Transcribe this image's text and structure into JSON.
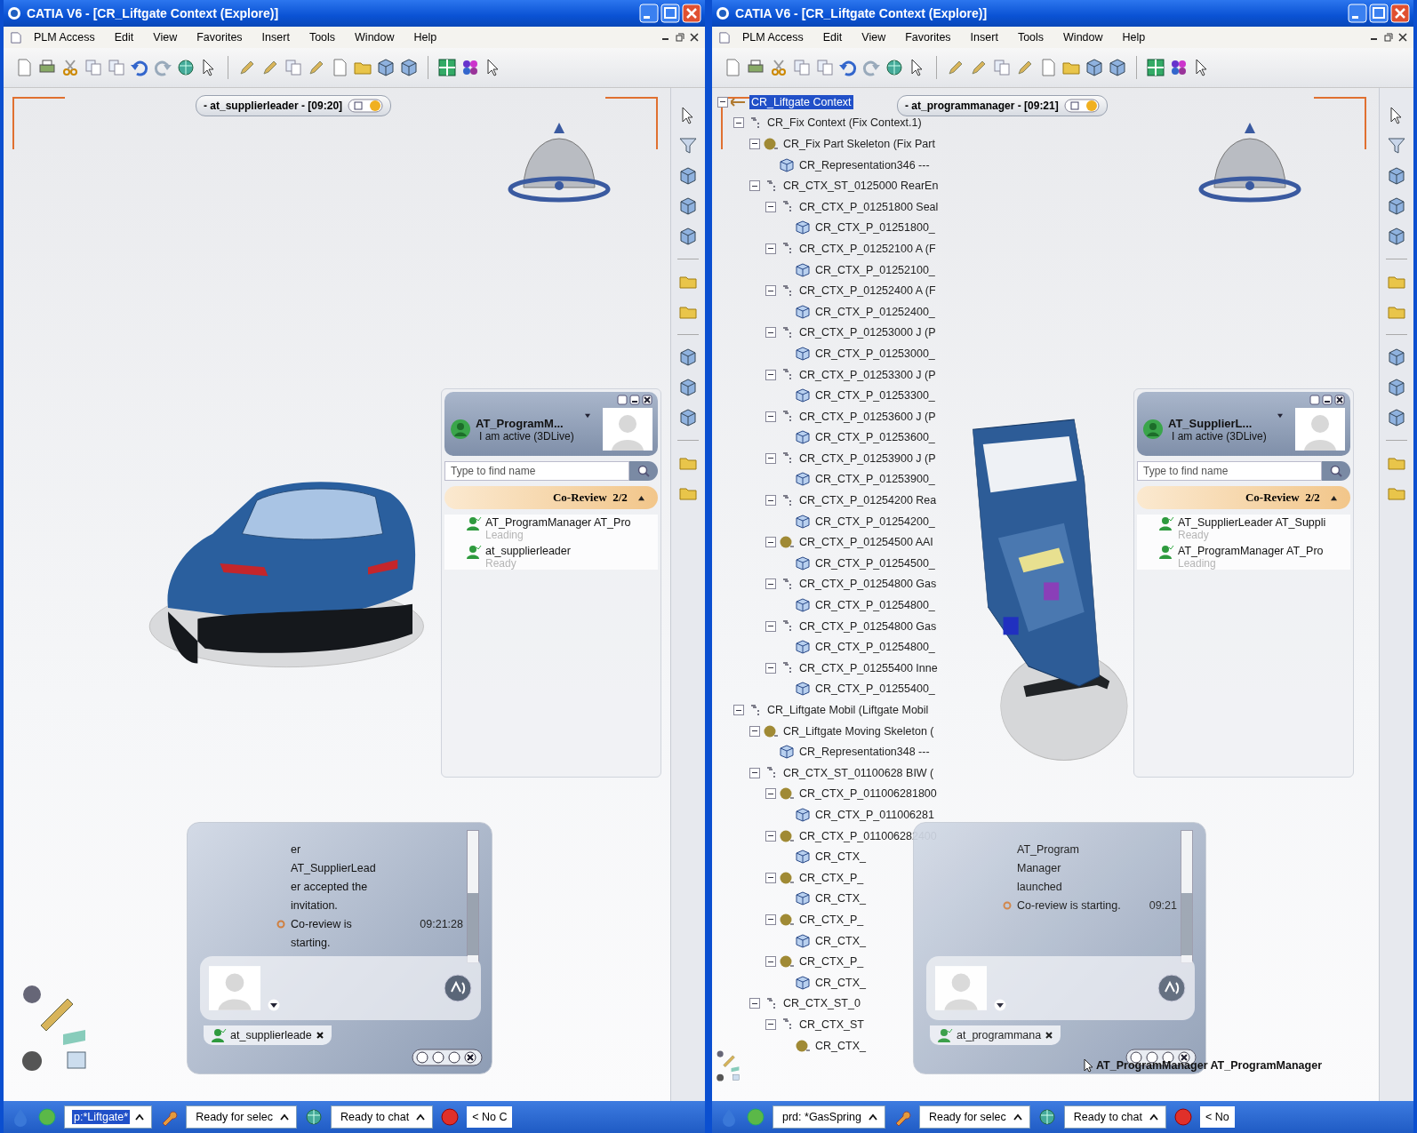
{
  "windows": [
    {
      "title": "CATIA V6 - [CR_Liftgate Context (Explore)]",
      "menu": [
        "PLM Access",
        "Edit",
        "View",
        "Favorites",
        "Insert",
        "Tools",
        "Window",
        "Help"
      ],
      "session": "- at_supplierleader - [09:20]",
      "model": {
        "kind": "car"
      },
      "contacts": {
        "name": "AT_ProgramM...",
        "status": "I am active (3DLive)",
        "search": {
          "placeholder": "Type to find name"
        },
        "group": {
          "label": "Co-Review  2/2",
          "expanded": true
        },
        "members": [
          {
            "name": "AT_ProgramManager AT_Pro",
            "state": "Leading"
          },
          {
            "name": "at_supplierleader",
            "state": "Ready"
          }
        ]
      },
      "chat": {
        "messages": [
          {
            "kind": "continuation",
            "lines": [
              "er",
              "AT_SupplierLead",
              "er accepted the",
              "invitation."
            ]
          },
          {
            "kind": "event",
            "lines": [
              "Co-review is",
              "starting."
            ],
            "time": "09:21:28"
          }
        ],
        "participant": "at_supplierleade"
      },
      "status_bar": [
        {
          "kind": "dropdown",
          "text": "p:*Liftgate*",
          "highlighted": true
        },
        {
          "kind": "dropdown",
          "text": "Ready for selec",
          "highlighted": false
        },
        {
          "kind": "dropdown",
          "text": "Ready to chat",
          "highlighted": false
        },
        {
          "kind": "label",
          "text": "< No C"
        }
      ]
    },
    {
      "title": "CATIA V6 - [CR_Liftgate Context (Explore)]",
      "menu": [
        "PLM Access",
        "Edit",
        "View",
        "Favorites",
        "Insert",
        "Tools",
        "Window",
        "Help"
      ],
      "session": "- at_programmanager - [09:21]",
      "model": {
        "kind": "liftgate"
      },
      "tree": [
        {
          "label": "CR_Liftgate Context",
          "kind": "root",
          "selected": true,
          "children": [
            {
              "label": "CR_Fix Context (Fix Context.1)",
              "kind": "product",
              "selected": false,
              "children": [
                {
                  "label": "CR_Fix Part Skeleton (Fix Part",
                  "kind": "part",
                  "selected": false,
                  "children": [
                    {
                      "label": "CR_Representation346 ---",
                      "kind": "representation",
                      "selected": false
                    }
                  ]
                },
                {
                  "label": "CR_CTX_ST_0125000 RearEn",
                  "kind": "product",
                  "selected": false,
                  "children": [
                    {
                      "label": "CR_CTX_P_01251800 Seal",
                      "kind": "product",
                      "selected": false,
                      "children": [
                        {
                          "label": "CR_CTX_P_01251800_",
                          "kind": "representation",
                          "selected": false
                        }
                      ]
                    },
                    {
                      "label": "CR_CTX_P_01252100 A (F",
                      "kind": "product",
                      "selected": false,
                      "children": [
                        {
                          "label": "CR_CTX_P_01252100_",
                          "kind": "representation",
                          "selected": false
                        }
                      ]
                    },
                    {
                      "label": "CR_CTX_P_01252400 A (F",
                      "kind": "product",
                      "selected": false,
                      "children": [
                        {
                          "label": "CR_CTX_P_01252400_",
                          "kind": "representation",
                          "selected": false
                        }
                      ]
                    },
                    {
                      "label": "CR_CTX_P_01253000 J (P",
                      "kind": "product",
                      "selected": false,
                      "children": [
                        {
                          "label": "CR_CTX_P_01253000_",
                          "kind": "representation",
                          "selected": false
                        }
                      ]
                    },
                    {
                      "label": "CR_CTX_P_01253300 J (P",
                      "kind": "product",
                      "selected": false,
                      "children": [
                        {
                          "label": "CR_CTX_P_01253300_",
                          "kind": "representation",
                          "selected": false
                        }
                      ]
                    },
                    {
                      "label": "CR_CTX_P_01253600 J (P",
                      "kind": "product",
                      "selected": false,
                      "children": [
                        {
                          "label": "CR_CTX_P_01253600_",
                          "kind": "representation",
                          "selected": false
                        }
                      ]
                    },
                    {
                      "label": "CR_CTX_P_01253900 J (P",
                      "kind": "product",
                      "selected": false,
                      "children": [
                        {
                          "label": "CR_CTX_P_01253900_",
                          "kind": "representation",
                          "selected": false
                        }
                      ]
                    },
                    {
                      "label": "CR_CTX_P_01254200 Rea",
                      "kind": "product",
                      "selected": false,
                      "children": [
                        {
                          "label": "CR_CTX_P_01254200_",
                          "kind": "representation",
                          "selected": false
                        }
                      ]
                    },
                    {
                      "label": "CR_CTX_P_01254500 AAI",
                      "kind": "part",
                      "selected": false,
                      "children": [
                        {
                          "label": "CR_CTX_P_01254500_",
                          "kind": "representation",
                          "selected": false
                        }
                      ]
                    },
                    {
                      "label": "CR_CTX_P_01254800 Gas",
                      "kind": "product",
                      "selected": false,
                      "children": [
                        {
                          "label": "CR_CTX_P_01254800_",
                          "kind": "representation",
                          "selected": false
                        }
                      ]
                    },
                    {
                      "label": "CR_CTX_P_01254800 Gas",
                      "kind": "product",
                      "selected": false,
                      "children": [
                        {
                          "label": "CR_CTX_P_01254800_",
                          "kind": "representation",
                          "selected": false
                        }
                      ]
                    },
                    {
                      "label": "CR_CTX_P_01255400 Inne",
                      "kind": "product",
                      "selected": false,
                      "children": [
                        {
                          "label": "CR_CTX_P_01255400_",
                          "kind": "representation",
                          "selected": false
                        }
                      ]
                    }
                  ]
                }
              ]
            },
            {
              "label": "CR_Liftgate Mobil (Liftgate Mobil",
              "kind": "product",
              "selected": false,
              "children": [
                {
                  "label": "CR_Liftgate Moving Skeleton (",
                  "kind": "part",
                  "selected": false,
                  "children": [
                    {
                      "label": "CR_Representation348 ---",
                      "kind": "representation",
                      "selected": false
                    }
                  ]
                },
                {
                  "label": "CR_CTX_ST_01100628 BIW (",
                  "kind": "product",
                  "selected": false,
                  "children": [
                    {
                      "label": "CR_CTX_P_011006281800",
                      "kind": "part",
                      "selected": false,
                      "children": [
                        {
                          "label": "CR_CTX_P_011006281",
                          "kind": "representation",
                          "selected": false
                        }
                      ]
                    },
                    {
                      "label": "CR_CTX_P_011006282400",
                      "kind": "part",
                      "selected": false,
                      "children": [
                        {
                          "label": "CR_CTX_",
                          "kind": "representation",
                          "selected": false
                        }
                      ]
                    },
                    {
                      "label": "CR_CTX_P_",
                      "kind": "part",
                      "selected": false,
                      "children": [
                        {
                          "label": "CR_CTX_",
                          "kind": "representation",
                          "selected": false
                        }
                      ]
                    },
                    {
                      "label": "CR_CTX_P_",
                      "kind": "part",
                      "selected": false,
                      "children": [
                        {
                          "label": "CR_CTX_",
                          "kind": "representation",
                          "selected": false
                        }
                      ]
                    },
                    {
                      "label": "CR_CTX_P_",
                      "kind": "part",
                      "selected": false,
                      "children": [
                        {
                          "label": "CR_CTX_",
                          "kind": "representation",
                          "selected": false
                        }
                      ]
                    }
                  ]
                },
                {
                  "label": "CR_CTX_ST_0",
                  "kind": "product",
                  "selected": false,
                  "children": [
                    {
                      "label": "CR_CTX_ST",
                      "kind": "product",
                      "selected": false,
                      "children": [
                        {
                          "label": "CR_CTX_",
                          "kind": "part",
                          "selected": false
                        }
                      ]
                    }
                  ]
                }
              ]
            }
          ]
        }
      ],
      "contacts": {
        "name": "AT_SupplierL...",
        "status": "I am active (3DLive)",
        "search": {
          "placeholder": "Type to find name"
        },
        "group": {
          "label": "Co-Review  2/2",
          "expanded": true
        },
        "members": [
          {
            "name": "AT_SupplierLeader AT_Suppli",
            "state": "Ready"
          },
          {
            "name": "AT_ProgramManager AT_Pro",
            "state": "Leading"
          }
        ]
      },
      "chat": {
        "messages": [
          {
            "kind": "continuation",
            "lines": [
              "AT_Program",
              "Manager",
              "launched"
            ]
          },
          {
            "kind": "event",
            "lines": [
              "Co-review is starting."
            ],
            "time": "09:21"
          }
        ],
        "participant": "at_programmana"
      },
      "tooltip": "AT_ProgramManager AT_ProgramManager",
      "status_bar": [
        {
          "kind": "dropdown",
          "text": "prd: *GasSpring",
          "highlighted": false
        },
        {
          "kind": "dropdown",
          "text": "Ready for selec",
          "highlighted": false
        },
        {
          "kind": "dropdown",
          "text": "Ready to chat",
          "highlighted": false
        },
        {
          "kind": "label",
          "text": "< No"
        }
      ]
    }
  ]
}
